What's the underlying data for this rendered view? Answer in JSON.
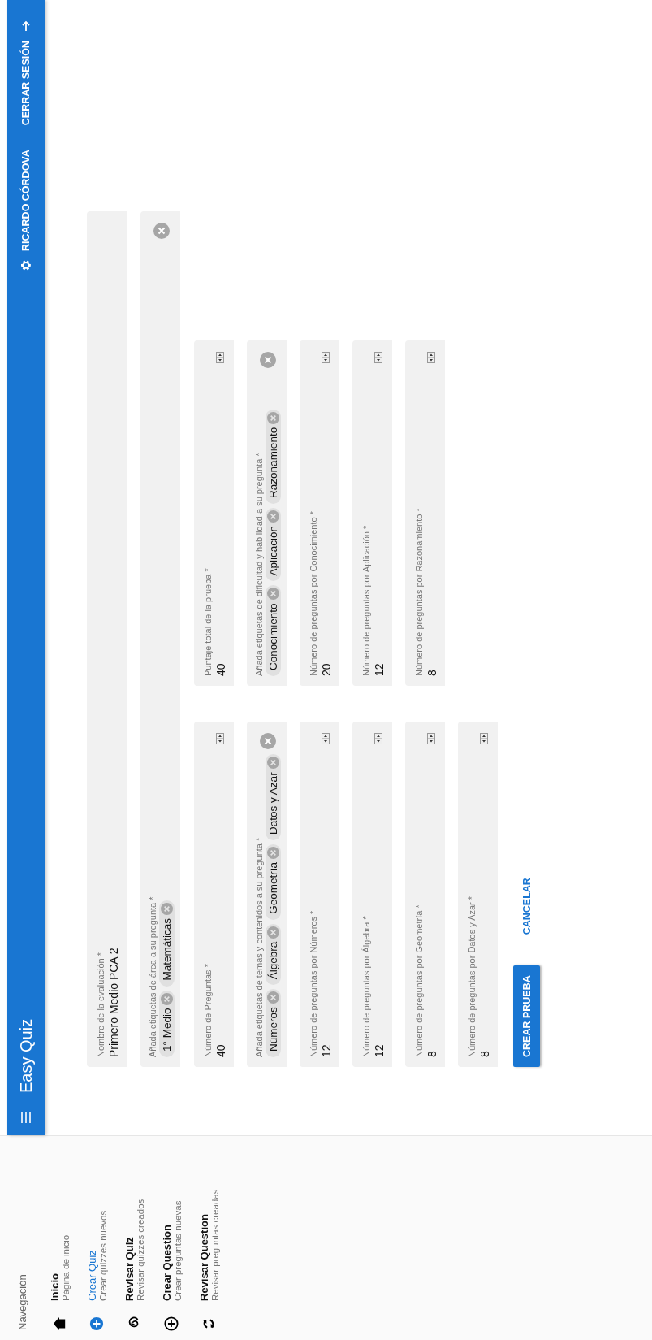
{
  "app_bar": {
    "title": "Easy Quiz",
    "user": "RICARDO CÓRDOVA",
    "logout": "CERRAR SESIÓN"
  },
  "sidebar": {
    "heading": "Navegación",
    "items": [
      {
        "title": "Inicio",
        "subtitle": "Página de inicio",
        "selected": false
      },
      {
        "title": "Crear Quiz",
        "subtitle": "Crear quizzes nuevos",
        "selected": true
      },
      {
        "title": "Revisar Quiz",
        "subtitle": "Revisar quizzes creados",
        "selected": false
      },
      {
        "title": "Crear Question",
        "subtitle": "Crear preguntas nuevas",
        "selected": false
      },
      {
        "title": "Revisar Question",
        "subtitle": "Revisar preguntas creadas",
        "selected": false
      }
    ]
  },
  "form": {
    "wide_fields": [
      {
        "kind": "text",
        "label": "Nombre de la evaluación *",
        "value": "Primero Medio PCA 2"
      },
      {
        "kind": "tags",
        "label": "Añada etiquetas de área a su pregunta *",
        "tags": [
          "1° Medio",
          "Matemáticas"
        ]
      }
    ],
    "grid_fields": [
      {
        "kind": "number",
        "label": "Número de Preguntas *",
        "value": "40"
      },
      {
        "kind": "number",
        "label": "Puntaje total de la prueba *",
        "value": "40"
      },
      {
        "kind": "tags",
        "label": "Añada etiquetas de temas y contenidos a su pregunta *",
        "tags": [
          "Números",
          "Álgebra",
          "Geometría",
          "Datos y Azar"
        ]
      },
      {
        "kind": "tags",
        "label": "Añada etiquetas de dificultad y habilidad a su pregunta *",
        "tags": [
          "Conocimiento",
          "Aplicación",
          "Razonamiento"
        ]
      },
      {
        "kind": "number",
        "label": "Número de preguntas por Números *",
        "value": "12"
      },
      {
        "kind": "number",
        "label": "Número de preguntas por Conocimiento *",
        "value": "20"
      },
      {
        "kind": "number",
        "label": "Número de preguntas por Álgebra *",
        "value": "12"
      },
      {
        "kind": "number",
        "label": "Número de preguntas por Aplicación *",
        "value": "12"
      },
      {
        "kind": "number",
        "label": "Número de preguntas por Geometría *",
        "value": "8"
      },
      {
        "kind": "number",
        "label": "Número de preguntas por Razonamiento *",
        "value": "8"
      },
      {
        "kind": "number",
        "label": "Número de preguntas por Datos y Azar *",
        "value": "8"
      }
    ],
    "submit": "CREAR PRUEBA",
    "cancel": "CANCELAR"
  }
}
